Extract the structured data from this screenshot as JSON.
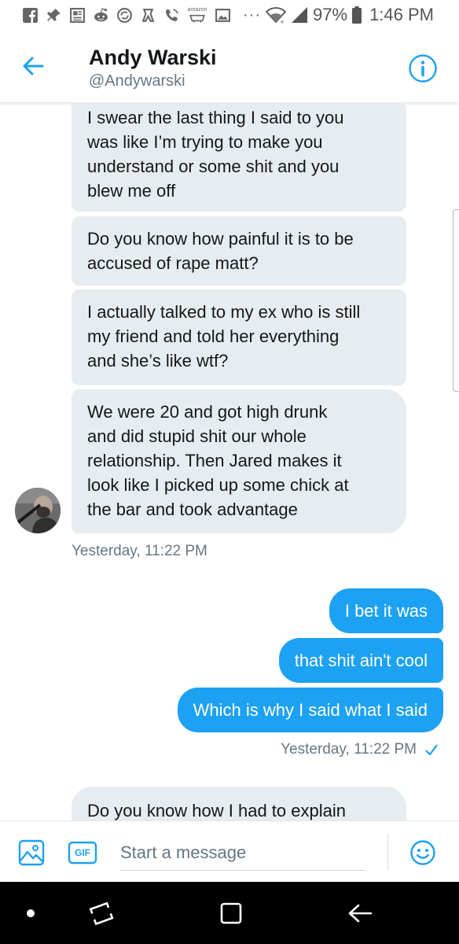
{
  "status_bar": {
    "battery": "97%",
    "time": "1:46 PM",
    "more": "···",
    "icons": [
      "facebook-icon",
      "pin-icon",
      "news-icon",
      "reddit-icon",
      "sync-icon",
      "person-icon",
      "call-icon",
      "amazon-icon",
      "image-icon",
      "wifi-icon",
      "signal-icon",
      "battery-icon"
    ],
    "amazon_label": "amazon"
  },
  "header": {
    "title": "Andy Warski",
    "handle": "@Andywarski",
    "accent_color": "#1da1f2"
  },
  "messages": [
    {
      "direction": "in",
      "lines": [
        "I swear the last thing I said to you",
        "was like I’m trying to make you",
        "understand or some shit and you",
        "blew me off"
      ]
    },
    {
      "direction": "in",
      "lines": [
        "Do you know how painful it is to be",
        "accused of rape matt?"
      ]
    },
    {
      "direction": "in",
      "lines": [
        "I actually talked to my ex who is still",
        "my friend and told her everything",
        "and she’s like wtf?"
      ]
    },
    {
      "direction": "in",
      "lines": [
        "We were 20 and got high drunk",
        "and did stupid shit our whole",
        "relationship. Then Jared makes it",
        "look like I picked up some chick at",
        "the bar and took advantage"
      ]
    },
    {
      "direction": "out",
      "text": "I bet it was"
    },
    {
      "direction": "out",
      "text": "that shit ain't cool"
    },
    {
      "direction": "out",
      "text": "Which is why I said what I said"
    },
    {
      "direction": "in",
      "lines": [
        "Do you know how I had to explain"
      ]
    }
  ],
  "timestamps": {
    "incoming": "Yesterday, 11:22 PM",
    "outgoing": "Yesterday, 11:22 PM",
    "outgoing_status_icon": "check-icon"
  },
  "composer": {
    "placeholder": "Start a message",
    "gif_label": "GIF"
  }
}
